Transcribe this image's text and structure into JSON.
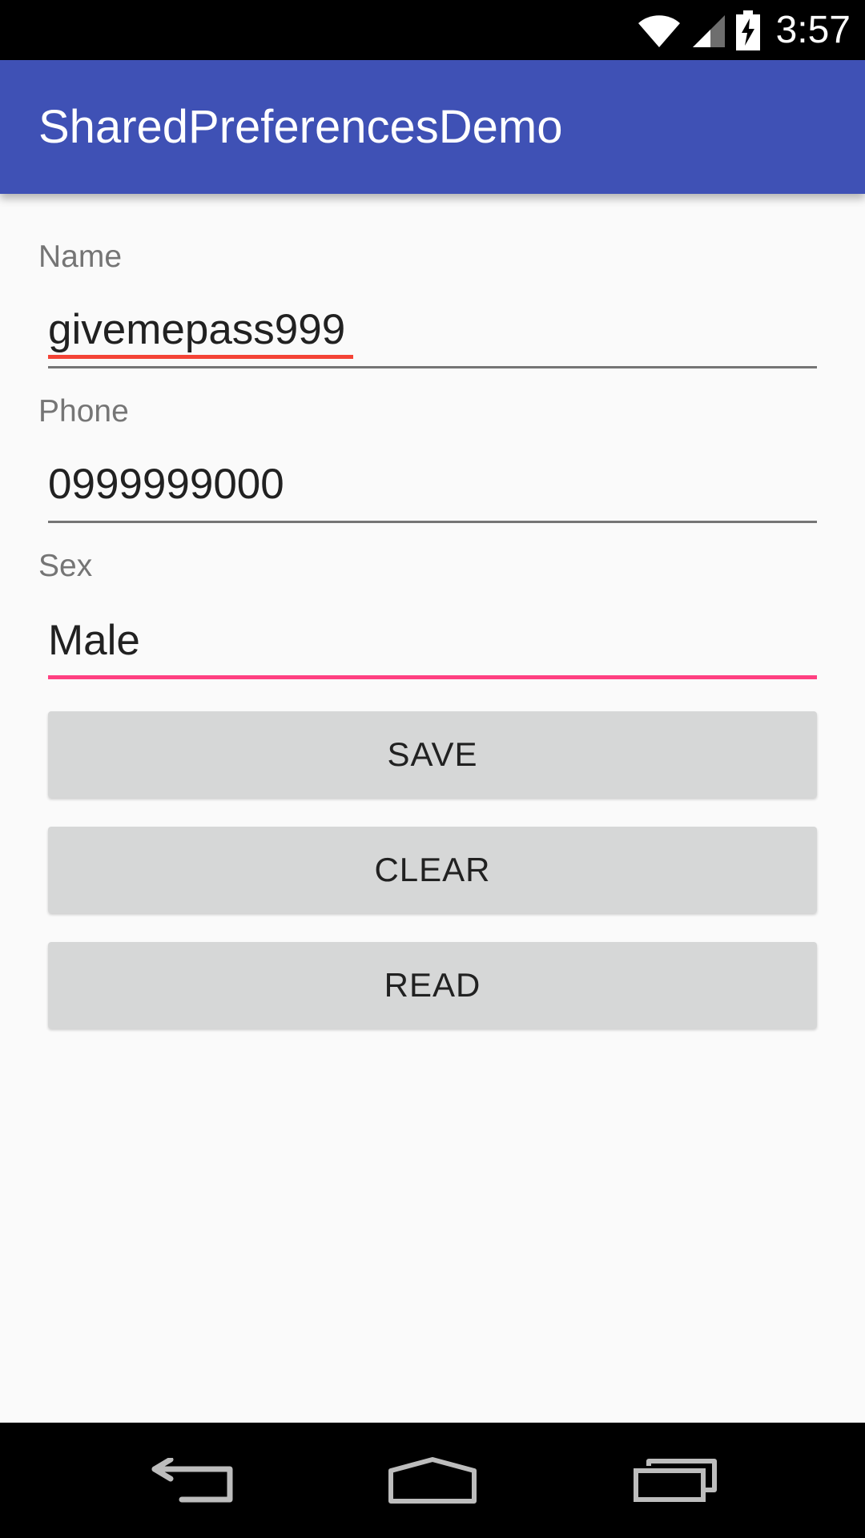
{
  "status_bar": {
    "time": "3:57",
    "icons": [
      "wifi-icon",
      "signal-icon",
      "battery-charging-icon"
    ]
  },
  "app_bar": {
    "title": "SharedPreferencesDemo",
    "color": "#3f51b5"
  },
  "form": {
    "name": {
      "label": "Name",
      "value": "givemepass999"
    },
    "phone": {
      "label": "Phone",
      "value": "0999999000"
    },
    "sex": {
      "label": "Sex",
      "value": "Male"
    }
  },
  "buttons": {
    "save": "SAVE",
    "clear": "CLEAR",
    "read": "READ"
  },
  "nav_bar": {
    "icons": [
      "back-icon",
      "home-icon",
      "recent-apps-icon"
    ]
  },
  "colors": {
    "accent": "#ff4081",
    "spell_error": "#f44336",
    "background": "#fafafa",
    "button": "#d6d7d7"
  }
}
